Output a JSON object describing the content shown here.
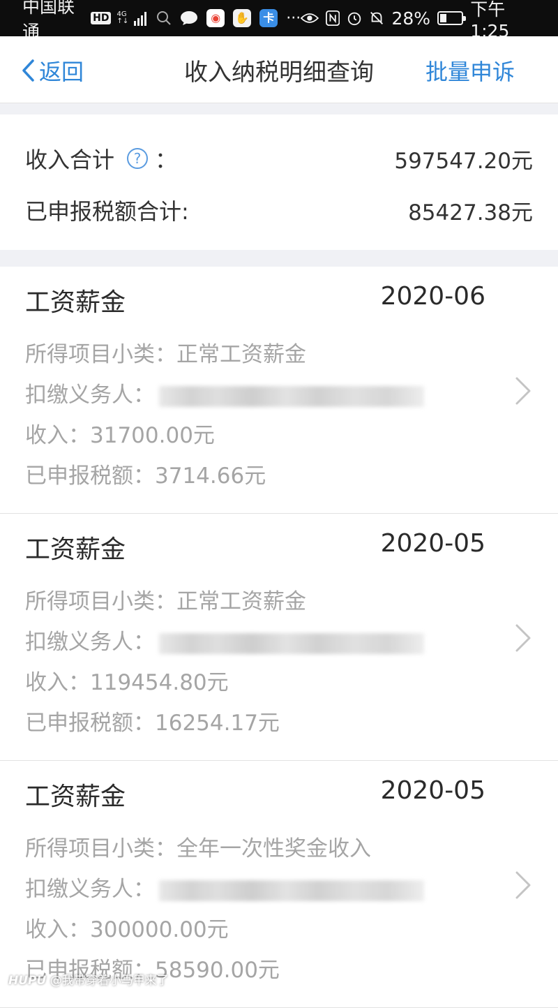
{
  "status_bar": {
    "carrier": "中国联通",
    "hd_badge": "HD",
    "network": "4G",
    "battery_text": "28%",
    "battery_level": 0.28,
    "time": "下午1:25",
    "icons": [
      "search-icon",
      "chat-bubble-icon",
      "browser-app-icon",
      "hand-app-icon",
      "app-icon",
      "more-icon",
      "eye-icon",
      "nfc-icon",
      "alarm-icon",
      "mute-bell-icon",
      "battery-icon"
    ]
  },
  "nav": {
    "back_label": "返回",
    "title": "收入纳税明细查询",
    "action_label": "批量申诉",
    "accent_color": "#2f86d8"
  },
  "summary": {
    "income_label": "收入合计",
    "colon": "：",
    "income_value": "597547.20元",
    "tax_label": "已申报税额合计:",
    "tax_value": "85427.38元"
  },
  "records": [
    {
      "type": "工资薪金",
      "date": "2020-06",
      "subcategory": "所得项目小类：正常工资薪金",
      "withholder_label": "扣缴义务人：",
      "income": "收入：31700.00元",
      "tax": "已申报税额：3714.66元"
    },
    {
      "type": "工资薪金",
      "date": "2020-05",
      "subcategory": "所得项目小类：正常工资薪金",
      "withholder_label": "扣缴义务人：",
      "income": "收入：119454.80元",
      "tax": "已申报税额：16254.17元"
    },
    {
      "type": "工资薪金",
      "date": "2020-05",
      "subcategory": "所得项目小类：全年一次性奖金收入",
      "withholder_label": "扣缴义务人：",
      "income": "收入：300000.00元",
      "tax": "已申报税额：58590.00元"
    }
  ],
  "watermark": {
    "brand": "HUPU",
    "text": "@我带穿着小马甲来了"
  }
}
